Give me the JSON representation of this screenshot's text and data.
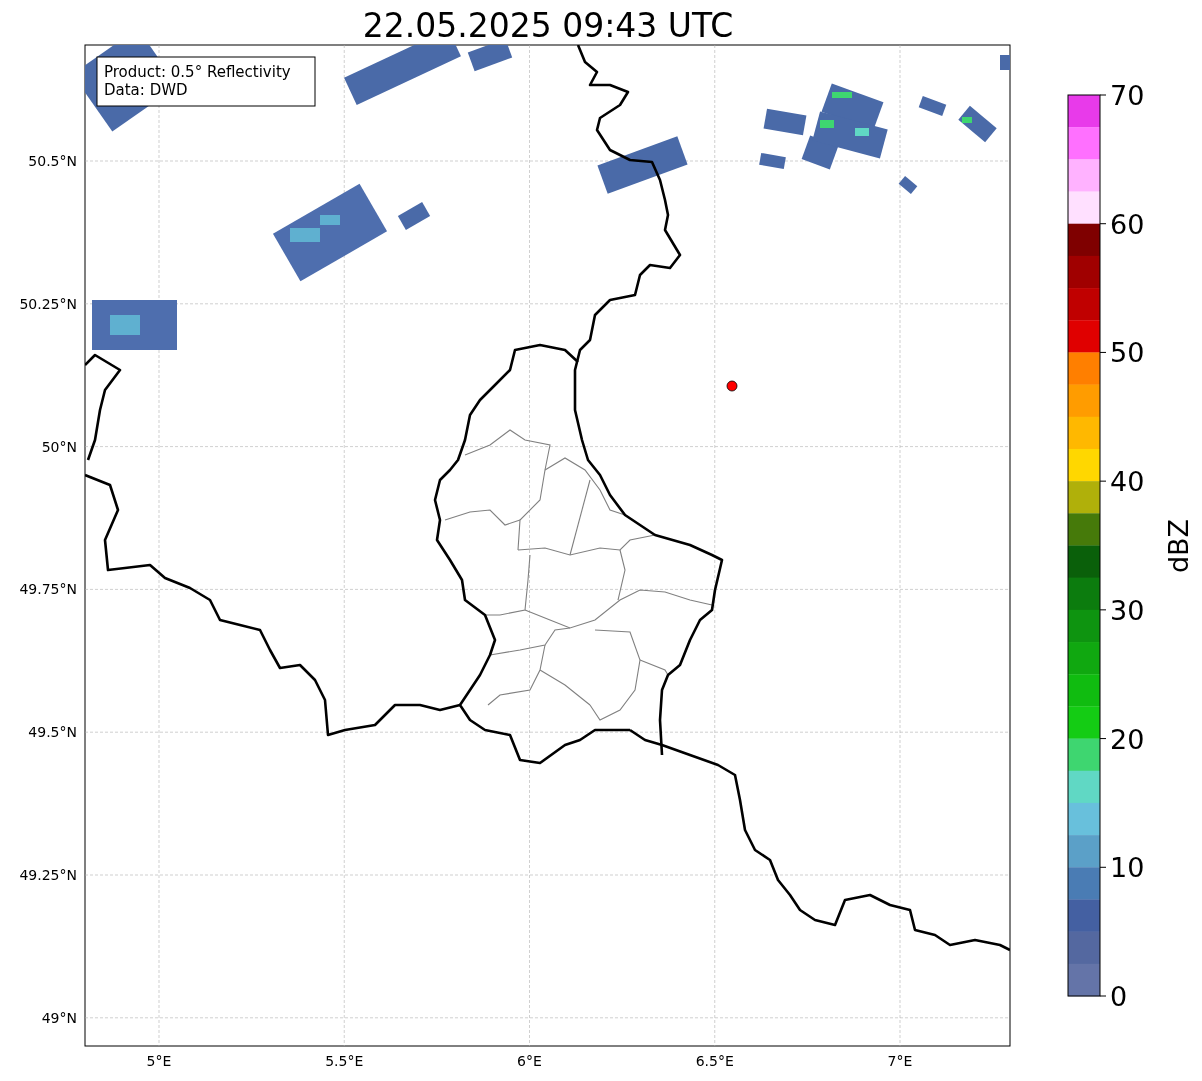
{
  "title": "22.05.2025 09:43 UTC",
  "info_box": {
    "lines": [
      "Product: 0.5° Reflectivity",
      "Data: DWD"
    ]
  },
  "map": {
    "longitude_labels": [
      "5°E",
      "5.5°E",
      "6°E",
      "6.5°E",
      "7°E"
    ],
    "latitude_labels": [
      "50.5°N",
      "50.25°N",
      "50°N",
      "49.75°N",
      "49.5°N",
      "49.25°N",
      "49°N"
    ]
  },
  "colorbar": {
    "label": "dBZ",
    "tick_labels": [
      "70",
      "60",
      "50",
      "40",
      "30",
      "20",
      "10",
      "0"
    ],
    "bins": [
      {
        "color": "#e83aea"
      },
      {
        "color": "#ff70ff"
      },
      {
        "color": "#ffb2ff"
      },
      {
        "color": "#ffe0ff"
      },
      {
        "color": "#7f0000"
      },
      {
        "color": "#a00000"
      },
      {
        "color": "#c00000"
      },
      {
        "color": "#e00000"
      },
      {
        "color": "#ff7f00"
      },
      {
        "color": "#ff9c00"
      },
      {
        "color": "#ffb800"
      },
      {
        "color": "#ffd700"
      },
      {
        "color": "#b0b00a"
      },
      {
        "color": "#467a0a"
      },
      {
        "color": "#0a600a"
      },
      {
        "color": "#0c7c0e"
      },
      {
        "color": "#0e9410"
      },
      {
        "color": "#10a810"
      },
      {
        "color": "#10bc10"
      },
      {
        "color": "#14cc14"
      },
      {
        "color": "#3ed670"
      },
      {
        "color": "#60d8c4"
      },
      {
        "color": "#68c0dc"
      },
      {
        "color": "#5ba0c8"
      },
      {
        "color": "#4a7cb4"
      },
      {
        "color": "#4460a2"
      },
      {
        "color": "#5468a0"
      },
      {
        "color": "#6474a8"
      }
    ]
  }
}
